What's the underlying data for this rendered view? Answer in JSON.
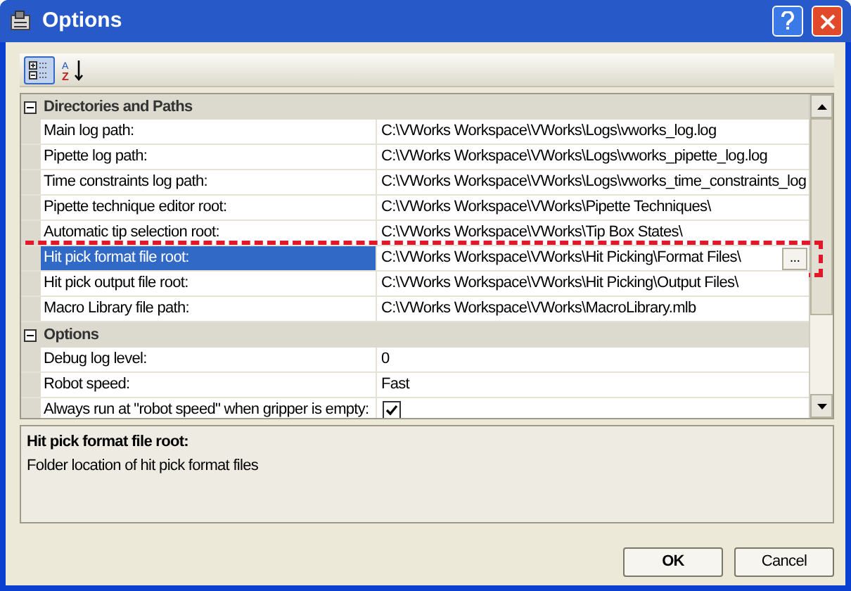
{
  "window": {
    "title": "Options"
  },
  "toolbar": [
    {
      "kind": "categorized",
      "selected": true
    },
    {
      "kind": "alphabetical",
      "selected": false,
      "glyphs": [
        "A",
        "Z"
      ]
    }
  ],
  "sections": [
    {
      "title": "Directories and Paths",
      "expanded": true,
      "rows": [
        {
          "label": "Main log path:",
          "value": "C:\\VWorks Workspace\\VWorks\\Logs\\vworks_log.log",
          "kind": "text",
          "selected": false
        },
        {
          "label": "Pipette log path:",
          "value": "C:\\VWorks Workspace\\VWorks\\Logs\\vworks_pipette_log.log",
          "kind": "text",
          "selected": false
        },
        {
          "label": "Time constraints log path:",
          "value": "C:\\VWorks Workspace\\VWorks\\Logs\\vworks_time_constraints_log",
          "kind": "text",
          "selected": false
        },
        {
          "label": "Pipette technique editor root:",
          "value": "C:\\VWorks Workspace\\VWorks\\Pipette Techniques\\",
          "kind": "text",
          "selected": false
        },
        {
          "label": "Automatic tip selection root:",
          "value": "C:\\VWorks Workspace\\VWorks\\Tip Box States\\",
          "kind": "text",
          "selected": false
        },
        {
          "label": "Hit pick format file root:",
          "value": "C:\\VWorks Workspace\\VWorks\\Hit Picking\\Format Files\\",
          "kind": "text",
          "selected": true,
          "browse": "..."
        },
        {
          "label": "Hit pick output file root:",
          "value": "C:\\VWorks Workspace\\VWorks\\Hit Picking\\Output Files\\",
          "kind": "text",
          "selected": false
        },
        {
          "label": "Macro Library file path:",
          "value": "C:\\VWorks Workspace\\VWorks\\MacroLibrary.mlb",
          "kind": "text",
          "selected": false
        }
      ]
    },
    {
      "title": "Options",
      "expanded": true,
      "rows": [
        {
          "label": "Debug log level:",
          "value": "0",
          "kind": "text",
          "selected": false
        },
        {
          "label": "Robot speed:",
          "value": "Fast",
          "kind": "text",
          "selected": false
        },
        {
          "label": "Always run at \"robot speed\" when gripper is empty:",
          "kind": "checkbox",
          "checked": true,
          "selected": false
        }
      ]
    }
  ],
  "description": {
    "title": "Hit pick format file root:",
    "text": "Folder location of hit pick format files"
  },
  "buttons": [
    {
      "label": "OK",
      "default": true
    },
    {
      "label": "Cancel",
      "default": false
    }
  ]
}
